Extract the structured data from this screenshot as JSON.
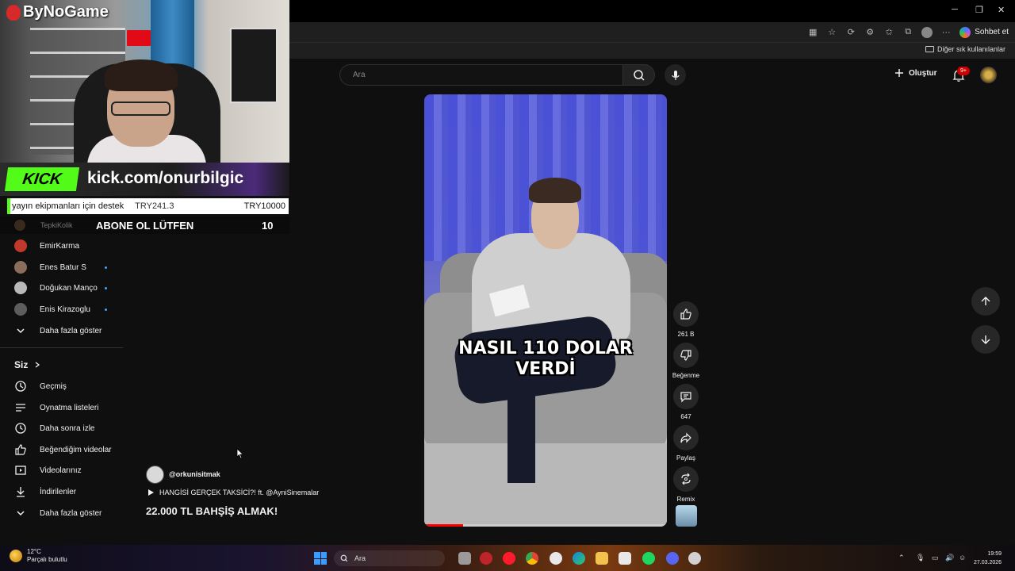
{
  "window": {
    "minimize": "─",
    "maximize": "❐",
    "close": "✕"
  },
  "toolbar": {
    "chat_label": "Sohbet et",
    "more_label": "···"
  },
  "bookmarks": {
    "other_label": "Diğer sık kullanılanlar"
  },
  "overlay": {
    "brand": "ByNoGame",
    "kick_logo": "KICK",
    "kick_url": "kick.com/onurbilgic",
    "donation_label": "yayın ekipmanları için destek",
    "donation_current": "TRY241.3",
    "donation_goal": "TRY10000",
    "subscribe_text": "ABONE OL LÜTFEN",
    "subscribe_count": "10"
  },
  "sidebar": {
    "subscriptions": [
      {
        "name": "TepkiKolik",
        "live": false,
        "color": "#3a2a1e"
      },
      {
        "name": "EmirKarma",
        "live": false,
        "color": "#c0392b"
      },
      {
        "name": "Enes Batur S",
        "live": true,
        "color": "#8a6d5a"
      },
      {
        "name": "Doğukan Manço",
        "live": true,
        "color": "#b9b9b9"
      },
      {
        "name": "Enis Kirazoglu",
        "live": true,
        "color": "#5d5d5d"
      }
    ],
    "show_more_1": "Daha fazla göster",
    "you_heading": "Siz",
    "you_items": [
      {
        "label": "Geçmiş",
        "icon": "history-icon"
      },
      {
        "label": "Oynatma listeleri",
        "icon": "playlist-icon"
      },
      {
        "label": "Daha sonra izle",
        "icon": "clock-icon"
      },
      {
        "label": "Beğendiğim videolar",
        "icon": "thumbs-up-icon"
      },
      {
        "label": "Videolarınız",
        "icon": "video-icon"
      },
      {
        "label": "İndirilenler",
        "icon": "download-icon"
      }
    ],
    "show_more_2": "Daha fazla göster"
  },
  "header": {
    "search_placeholder": "Ara",
    "create_label": "Oluştur",
    "notification_badge": "9+"
  },
  "short": {
    "caption_line1": "NASIL 110 DOLAR",
    "caption_line2": "VERDİ",
    "progress": 0.16,
    "channel": "@orkunisitmak",
    "related_video": "HANGİSİ GERÇEK TAKSİCİ?! ft. @AyniSinemalar",
    "title": "22.000 TL BAHŞİŞ ALMAK!"
  },
  "actions": {
    "like_count": "261 B",
    "dislike_label": "Beğenme",
    "comment_count": "647",
    "share_label": "Paylaş",
    "remix_label": "Remix"
  },
  "taskbar": {
    "temperature": "12°C",
    "weather_desc": "Parçalı bulutlu",
    "search_placeholder": "Ara",
    "time": "19:59",
    "date": "27.03.2026"
  }
}
